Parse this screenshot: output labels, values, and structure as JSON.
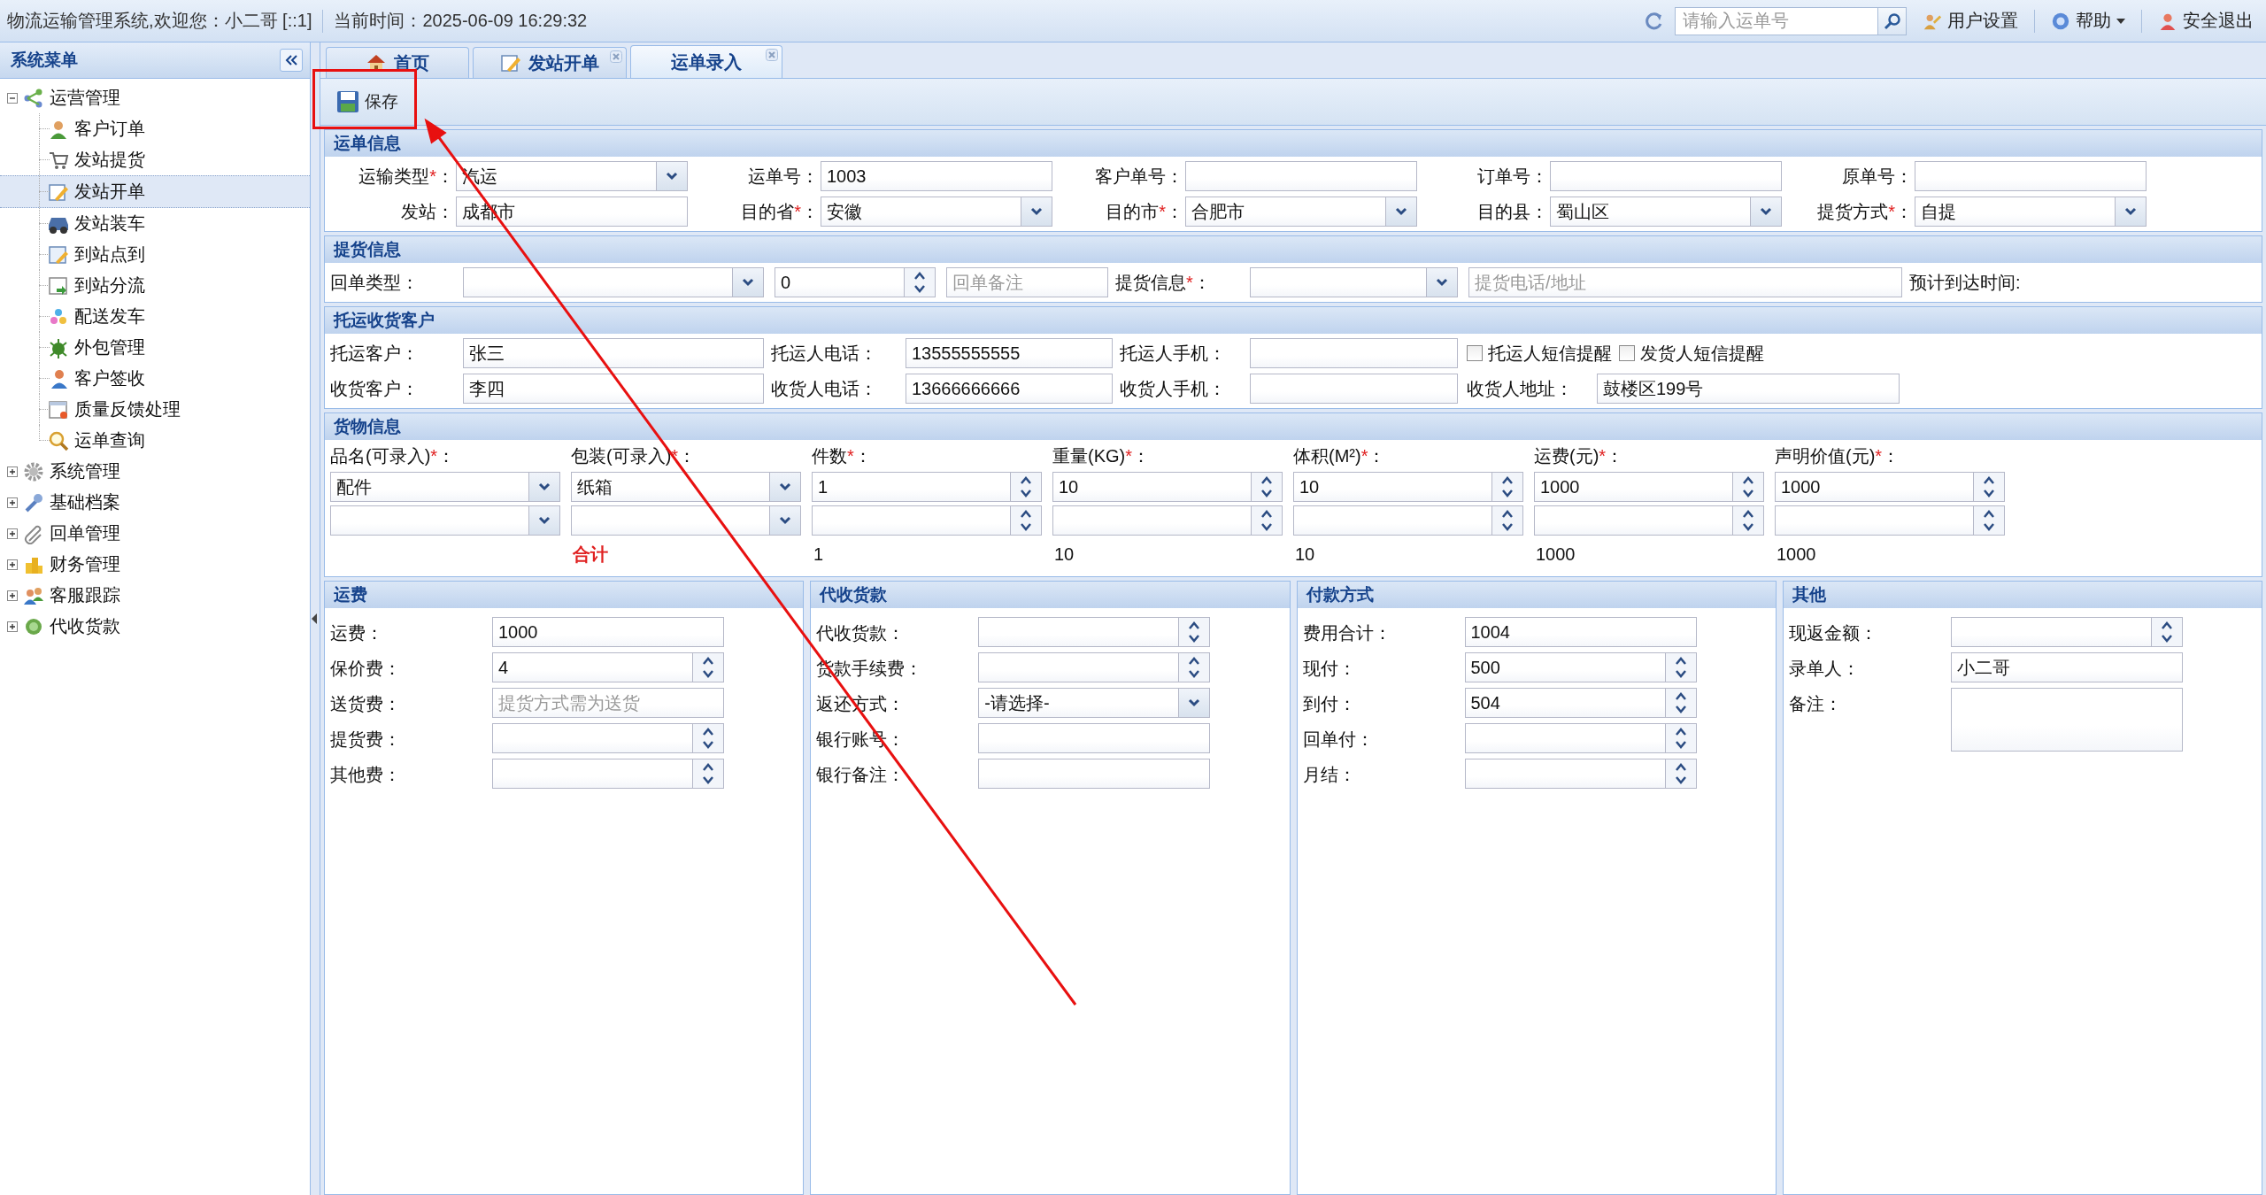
{
  "top_bar": {
    "welcome": "物流运输管理系统,欢迎您：小二哥  [::1]",
    "time": "当前时间：2025-06-09 16:29:32",
    "search": {
      "placeholder": "请输入运单号"
    },
    "links": [
      {
        "label": "用户设置",
        "caret": false
      },
      {
        "label": "帮助",
        "caret": true
      },
      {
        "label": "安全退出",
        "caret": false
      }
    ]
  },
  "sidebar": {
    "title": "系统菜单",
    "items": [
      {
        "label": "运营管理",
        "expanded": true,
        "selected": false,
        "children": [
          {
            "label": "客户订单",
            "selected": false
          },
          {
            "label": "发站提货",
            "selected": false
          },
          {
            "label": "发站开单",
            "selected": true
          },
          {
            "label": "发站装车",
            "selected": false
          },
          {
            "label": "到站点到",
            "selected": false
          },
          {
            "label": "到站分流",
            "selected": false
          },
          {
            "label": "配送发车",
            "selected": false
          },
          {
            "label": "外包管理",
            "selected": false
          },
          {
            "label": "客户签收",
            "selected": false
          },
          {
            "label": "质量反馈处理",
            "selected": false
          },
          {
            "label": "运单查询",
            "selected": false
          }
        ]
      },
      {
        "label": "系统管理",
        "expanded": false,
        "selected": false
      },
      {
        "label": "基础档案",
        "expanded": false,
        "selected": false
      },
      {
        "label": "回单管理",
        "expanded": false,
        "selected": false
      },
      {
        "label": "财务管理",
        "expanded": false,
        "selected": false
      },
      {
        "label": "客服跟踪",
        "expanded": false,
        "selected": false
      },
      {
        "label": "代收货款",
        "expanded": false,
        "selected": false
      }
    ]
  },
  "tabs": [
    {
      "label": "首页",
      "selected": false,
      "closable": false
    },
    {
      "label": "发站开单",
      "selected": false,
      "closable": true
    },
    {
      "label": "运单录入",
      "selected": true,
      "closable": true
    }
  ],
  "toolbar": {
    "buttons": [
      "保存"
    ]
  },
  "sections": [
    {
      "title": "运单信息",
      "rows": [
        [
          {
            "label": "运输类型",
            "mark": "*",
            "label_end": "：",
            "kind": "select",
            "value": "汽运"
          },
          {
            "label": "运单号：",
            "kind": "text",
            "value": "1003"
          },
          {
            "label": "客户单号：",
            "kind": "text"
          },
          {
            "label": "订单号：",
            "kind": "text"
          },
          {
            "label": "原单号：",
            "kind": "text"
          }
        ],
        [
          {
            "label": "发站：",
            "kind": "text",
            "value": "成都市"
          },
          {
            "label": "目的省",
            "mark": "*",
            "label_end": "：",
            "kind": "select",
            "value": "安徽"
          },
          {
            "label": "目的市",
            "mark": "*",
            "label_end": "：",
            "kind": "select",
            "value": "合肥市"
          },
          {
            "label": "目的县：",
            "kind": "select",
            "value": "蜀山区"
          },
          {
            "label": "提货方式",
            "mark": "*",
            "label_end": "：",
            "kind": "select",
            "value": "自提"
          }
        ]
      ]
    },
    {
      "title": "提货信息",
      "rows": [
        [
          {
            "label": "回单类型：",
            "kind": "select"
          },
          {
            "kind": "spin",
            "value": "0"
          },
          {
            "kind": "text",
            "placeholder": "回单备注"
          },
          {
            "label": "提货信息",
            "mark": "*",
            "label_end": "：",
            "kind": "select"
          },
          {
            "kind": "text",
            "placeholder": "提货电话/地址"
          },
          {
            "label": "预计到达时间:",
            "kind": "none"
          }
        ]
      ]
    },
    {
      "title": "托运收货客户",
      "rows": [
        [
          {
            "label": "托运客户：",
            "kind": "text",
            "value": "张三"
          },
          {
            "label": "托运人电话：",
            "kind": "text",
            "value": "13555555555"
          },
          {
            "label": "托运人手机：",
            "kind": "text"
          },
          {
            "label": "托运人短信提醒",
            "kind": "checkbox",
            "checked": false
          },
          {
            "label": "发货人短信提醒",
            "kind": "checkbox",
            "checked": false
          }
        ],
        [
          {
            "label": "收货客户：",
            "kind": "text",
            "value": "李四"
          },
          {
            "label": "收货人电话：",
            "kind": "text",
            "value": "13666666666"
          },
          {
            "label": "收货人手机：",
            "kind": "text"
          },
          {
            "label": "收货人地址：",
            "kind": "text",
            "value": "鼓楼区199号"
          }
        ]
      ]
    }
  ],
  "goods": {
    "title": "货物信息",
    "columns": [
      {
        "label": "品名(可录入)",
        "mark": "*",
        "label_end": "：",
        "kind": "select",
        "rows": [
          {
            "value": "配件"
          },
          {}
        ]
      },
      {
        "label": "包装(可录入)",
        "mark": "*",
        "label_end": "：",
        "kind": "select",
        "rows": [
          {
            "value": "纸箱"
          },
          {}
        ],
        "total": {
          "text": "合计",
          "kind": "caption"
        }
      },
      {
        "label": "件数",
        "mark": "*",
        "label_end": "：",
        "kind": "spin",
        "rows": [
          {
            "value": "1"
          },
          {}
        ],
        "total": {
          "text": "1",
          "kind": "sum"
        }
      },
      {
        "label": "重量(KG)",
        "mark": "*",
        "label_end": "：",
        "kind": "spin",
        "rows": [
          {
            "value": "10"
          },
          {}
        ],
        "total": {
          "text": "10",
          "kind": "sum"
        }
      },
      {
        "label": "体积(M²)",
        "mark": "*",
        "label_end": "：",
        "kind": "spin",
        "rows": [
          {
            "value": "10"
          },
          {}
        ],
        "total": {
          "text": "10",
          "kind": "sum"
        }
      },
      {
        "label": "运费(元)",
        "mark": "*",
        "label_end": "：",
        "kind": "spin",
        "rows": [
          {
            "value": "1000"
          },
          {}
        ],
        "total": {
          "text": "1000",
          "kind": "sum"
        }
      },
      {
        "label": "声明价值(元)",
        "mark": "*",
        "label_end": "：",
        "kind": "spin",
        "rows": [
          {
            "value": "1000"
          },
          {}
        ],
        "total": {
          "text": "1000",
          "kind": "sum"
        }
      }
    ]
  },
  "panels": [
    {
      "title": "运费",
      "rows": [
        {
          "label": "运费：",
          "kind": "text",
          "value": "1000"
        },
        {
          "label": "保价费：",
          "kind": "spin",
          "value": "4"
        },
        {
          "label": "送货费：",
          "kind": "text",
          "placeholder": "提货方式需为送货"
        },
        {
          "label": "提货费：",
          "kind": "spin"
        },
        {
          "label": "其他费：",
          "kind": "spin"
        }
      ]
    },
    {
      "title": "代收货款",
      "rows": [
        {
          "label": "代收货款：",
          "kind": "spin"
        },
        {
          "label": "货款手续费：",
          "kind": "spin"
        },
        {
          "label": "返还方式：",
          "kind": "select",
          "value": "-请选择-"
        },
        {
          "label": "银行账号：",
          "kind": "text"
        },
        {
          "label": "银行备注：",
          "kind": "text"
        }
      ]
    },
    {
      "title": "付款方式",
      "rows": [
        {
          "label": "费用合计：",
          "kind": "text",
          "value": "1004"
        },
        {
          "label": "现付：",
          "kind": "spin",
          "value": "500"
        },
        {
          "label": "到付：",
          "kind": "spin",
          "value": "504"
        },
        {
          "label": "回单付：",
          "kind": "spin"
        },
        {
          "label": "月结：",
          "kind": "spin"
        }
      ]
    },
    {
      "title": "其他",
      "rows": [
        {
          "label": "现返金额：",
          "kind": "spin"
        },
        {
          "label": "录单人：",
          "kind": "text",
          "value": "小二哥"
        },
        {
          "label": "备注：",
          "kind": "textarea"
        }
      ]
    }
  ],
  "annotation": {
    "highlight_box": true,
    "arrow": true
  }
}
